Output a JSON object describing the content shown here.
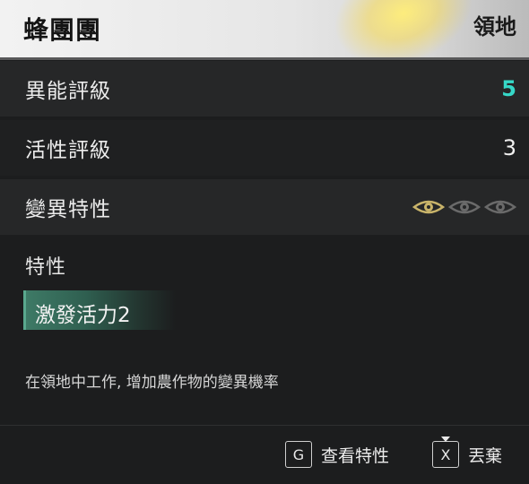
{
  "header": {
    "title": "蜂團團",
    "category": "領地"
  },
  "stats": [
    {
      "label": "異能評級",
      "value": "5",
      "accent": "#36d8c8"
    },
    {
      "label": "活性評級",
      "value": "3"
    },
    {
      "label": "變異特性",
      "icon": "eye-icon",
      "filled": 1,
      "total": 3
    }
  ],
  "traits": {
    "section_title": "特性",
    "items": [
      {
        "name": "激發活力2"
      }
    ],
    "description": "在領地中工作, 增加農作物的變異機率"
  },
  "footer": {
    "view_key": "G",
    "view_label": "查看特性",
    "drop_key": "X",
    "drop_label": "丟棄"
  },
  "colors": {
    "accent": "#36d8c8",
    "eye_active": "#c9b46a",
    "eye_inactive": "#6a6a6a",
    "trait_chip": "#3e7a66"
  }
}
